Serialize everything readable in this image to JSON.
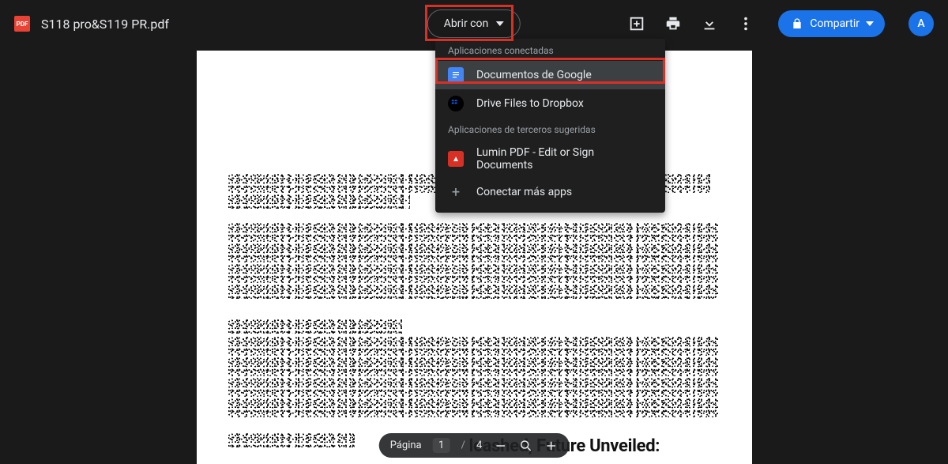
{
  "header": {
    "pdf_badge": "PDF",
    "filename": "S118 pro&S119 PR.pdf",
    "open_with_label": "Abrir con"
  },
  "share": {
    "label": "Compartir"
  },
  "avatar": {
    "initial": "A"
  },
  "dropdown": {
    "section_connected": "Aplicaciones conectadas",
    "items_connected": [
      {
        "label": "Documentos de Google"
      },
      {
        "label": "Drive Files to Dropbox"
      }
    ],
    "section_suggested": "Aplicaciones de terceros sugeridas",
    "items_suggested": [
      {
        "label": "Lumin PDF - Edit or Sign Documents"
      }
    ],
    "connect_more": "Conectar más apps"
  },
  "document": {
    "visible_heading_fragment": "leashed, Future Unveiled:"
  },
  "pager": {
    "label": "Página",
    "current": "1",
    "separator": "/",
    "total": "4"
  }
}
